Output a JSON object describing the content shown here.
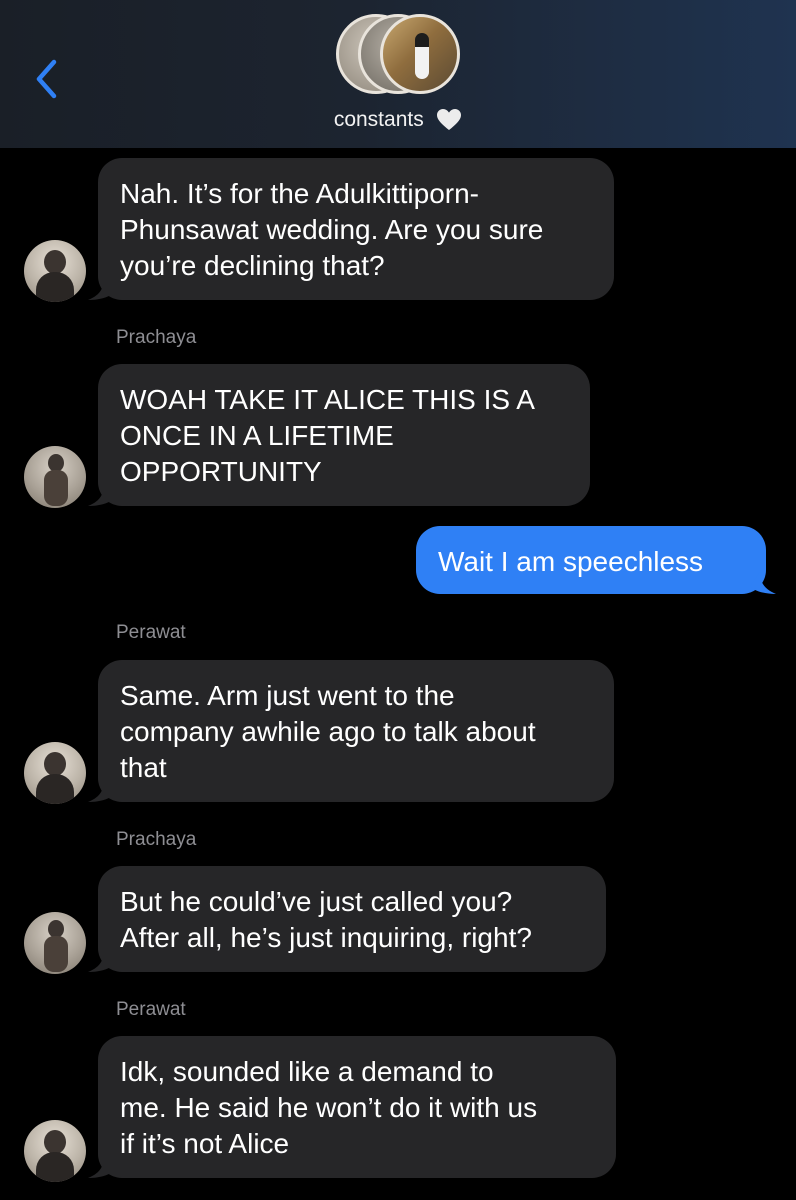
{
  "header": {
    "title": "constants",
    "accent_color": "#2f80f5",
    "icons": {
      "back": "chevron-left-icon",
      "heart": "white-heart-icon"
    }
  },
  "messages": [
    {
      "kind": "incoming",
      "text": "Nah. It’s for the Adulkittiporn-\nPhunsawat wedding. Are you sure\nyou’re declining that?"
    },
    {
      "kind": "incoming",
      "sender": "Prachaya",
      "text": "WOAH TAKE IT ALICE THIS IS A\nONCE IN A LIFETIME\nOPPORTUNITY"
    },
    {
      "kind": "outgoing",
      "text": "Wait I am speechless"
    },
    {
      "kind": "incoming",
      "sender": "Perawat",
      "text": "Same. Arm just went to the\ncompany awhile ago to talk about\nthat"
    },
    {
      "kind": "incoming",
      "sender": "Prachaya",
      "text": "But he could’ve just called you?\nAfter all, he’s just inquiring, right?"
    },
    {
      "kind": "incoming",
      "sender": "Perawat",
      "text": "Idk, sounded like a demand to\nme. He said he won’t do it with us\nif it’s not Alice"
    }
  ]
}
